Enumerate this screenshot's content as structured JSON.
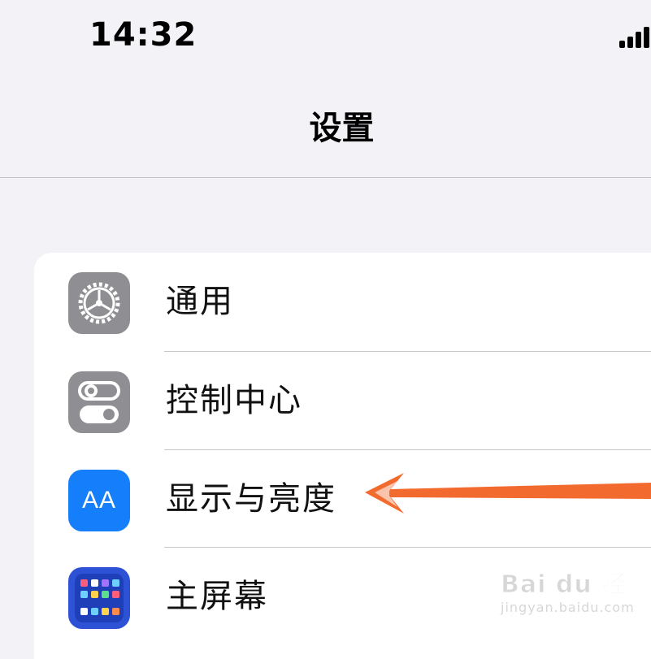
{
  "status_bar": {
    "time": "14:32"
  },
  "nav": {
    "title": "设置"
  },
  "settings": {
    "items": [
      {
        "label": "通用",
        "icon": "gear-icon",
        "icon_color": "#8e8e93"
      },
      {
        "label": "控制中心",
        "icon": "toggles-icon",
        "icon_color": "#8e8e93"
      },
      {
        "label": "显示与亮度",
        "icon": "text-size-icon",
        "icon_color": "#147efb",
        "icon_text": "AA"
      },
      {
        "label": "主屏幕",
        "icon": "home-screen-icon",
        "icon_color": "#2d52d6"
      }
    ]
  },
  "annotation": {
    "arrow_color": "#f26a2e"
  },
  "watermark": {
    "brand": "Bai du 经验",
    "sub": "jingyan.baidu.com"
  }
}
